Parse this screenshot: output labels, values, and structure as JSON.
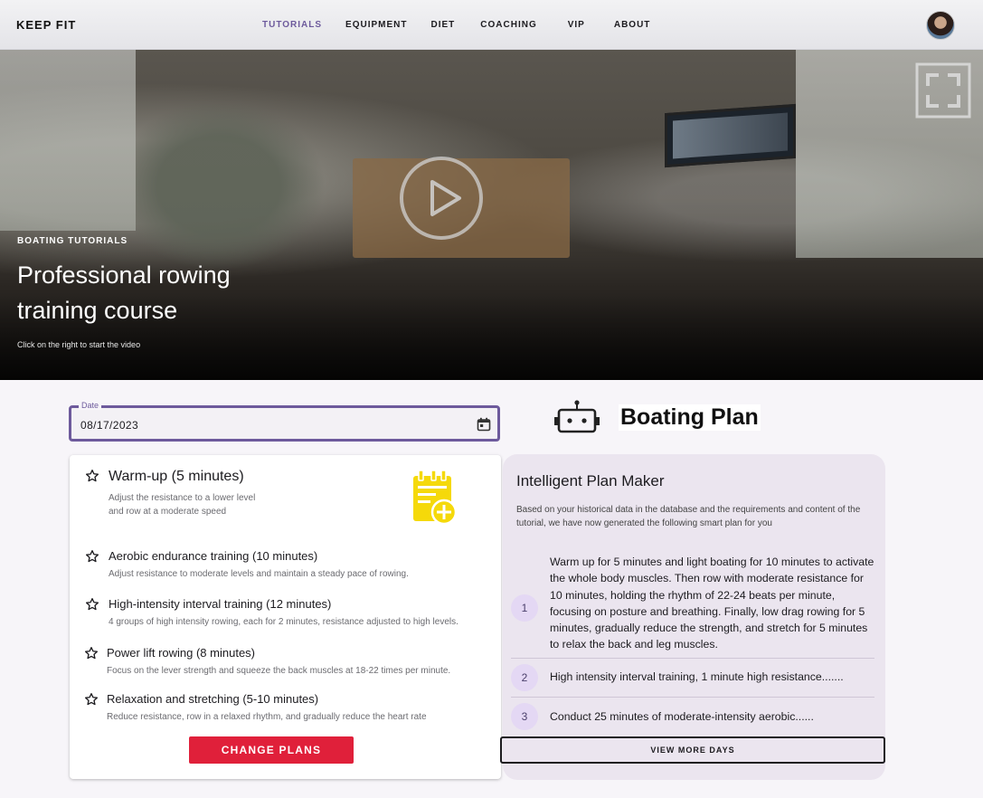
{
  "header": {
    "brand": "KEEP FIT",
    "nav": [
      "TUTORIALS",
      "EQUIPMENT",
      "DIET",
      "COACHING",
      "VIP",
      "ABOUT"
    ],
    "active_nav": "TUTORIALS"
  },
  "hero": {
    "eyebrow": "BOATING TUTORIALS",
    "title": "Professional rowing training course",
    "subtitle": "Click on the right to start the video"
  },
  "date_field": {
    "label": "Date",
    "value": "08/17/2023"
  },
  "plan_section": {
    "heading": "Boating Plan"
  },
  "plans": [
    {
      "title": "Warm-up (5 minutes)",
      "desc": "Adjust the resistance to a lower level and row at a moderate speed"
    },
    {
      "title": "Aerobic endurance training (10 minutes)",
      "desc": "Adjust resistance to moderate levels and maintain a steady pace of rowing."
    },
    {
      "title": "High-intensity interval training (12 minutes)",
      "desc": "4 groups of high intensity rowing, each for 2 minutes, resistance adjusted to high levels."
    },
    {
      "title": "Power lift rowing (8 minutes)",
      "desc": "Focus on the lever strength and squeeze the back muscles at 18-22 times per minute."
    },
    {
      "title": "Relaxation and stretching (5-10 minutes)",
      "desc": "Reduce resistance, row in a relaxed rhythm, and gradually reduce the heart rate"
    }
  ],
  "change_button": "CHANGE PLANS",
  "smart_plan": {
    "title": "Intelligent Plan Maker",
    "desc": "Based on your historical data in the database and the requirements and content of the tutorial, we have now generated the following smart plan for you",
    "steps": [
      {
        "num": "1",
        "text": "Warm up for 5 minutes and light boating for 10 minutes to activate the whole body muscles. Then row with moderate resistance for 10 minutes, holding the rhythm of 22-24 beats per minute, focusing on posture and breathing. Finally, low drag rowing for 5 minutes, gradually reduce the strength, and stretch for 5 minutes to relax the back and leg muscles."
      },
      {
        "num": "2",
        "text": "High intensity interval training, 1 minute high resistance......."
      },
      {
        "num": "3",
        "text": "Conduct 25 minutes of moderate-intensity aerobic......"
      }
    ],
    "more_button": "VIEW MORE DAYS"
  },
  "colors": {
    "accent": "#6d5a9c",
    "cta": "#e0203a",
    "icon_yellow": "#f5d90a",
    "smart_card_bg": "#ebe5ef"
  }
}
